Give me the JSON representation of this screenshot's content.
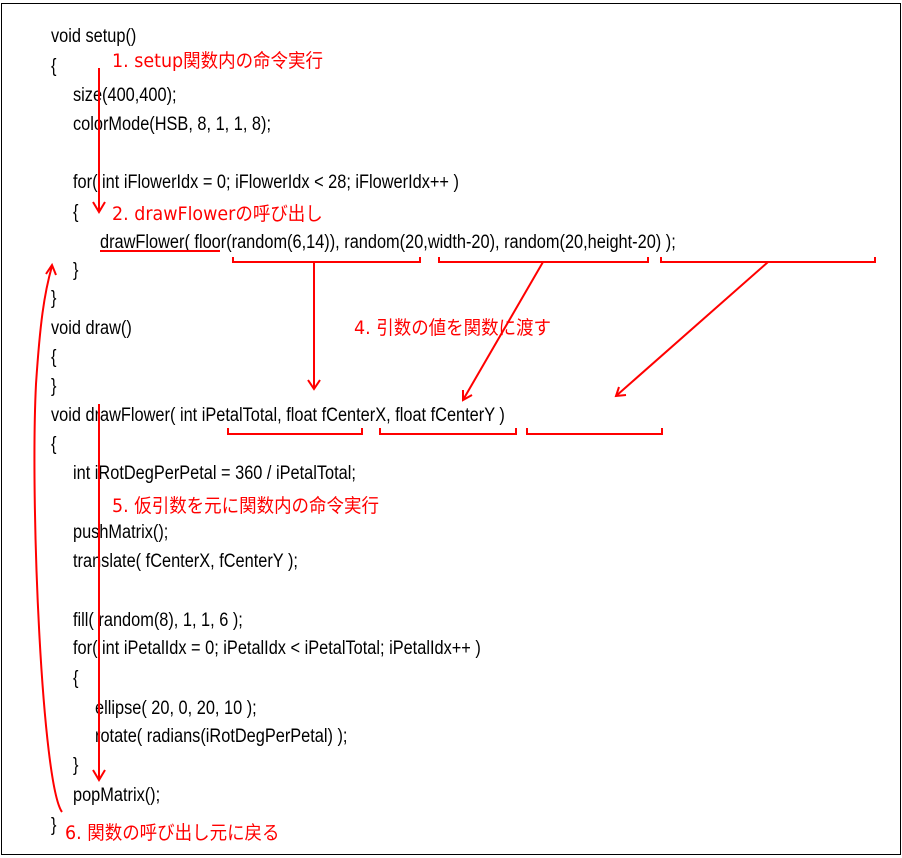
{
  "code": [
    "void setup()",
    "{",
    "size(400,400);",
    "colorMode(HSB, 8, 1, 1, 8);",
    "for( int iFlowerIdx = 0; iFlowerIdx < 28; iFlowerIdx++ )",
    "{",
    "drawFlower( floor(random(6,14)), random(20,width-20), random(20,height-20) );",
    "}",
    "}",
    "void draw()",
    "{",
    "}",
    "void drawFlower( int iPetalTotal, float fCenterX, float fCenterY )",
    "{",
    "int iRotDegPerPetal = 360 / iPetalTotal;",
    "pushMatrix();",
    "translate( fCenterX, fCenterY );",
    "fill( random(8), 1, 1, 6 );",
    "for( int iPetalIdx = 0; iPetalIdx < iPetalTotal; iPetalIdx++ )",
    "{",
    "ellipse( 20, 0, 20, 10 );",
    "rotate( radians(iRotDegPerPetal) );",
    "}",
    "popMatrix();",
    "}"
  ],
  "annotations": {
    "step1": "1. setup関数内の命令実行",
    "step2": "2. drawFlowerの呼び出し",
    "step4": "4. 引数の値を関数に渡す",
    "step5": "5. 仮引数を元に関数内の命令実行",
    "step6": "6. 関数の呼び出し元に戻る"
  },
  "colors": {
    "annotation": "#ff0000",
    "code": "#000000"
  }
}
